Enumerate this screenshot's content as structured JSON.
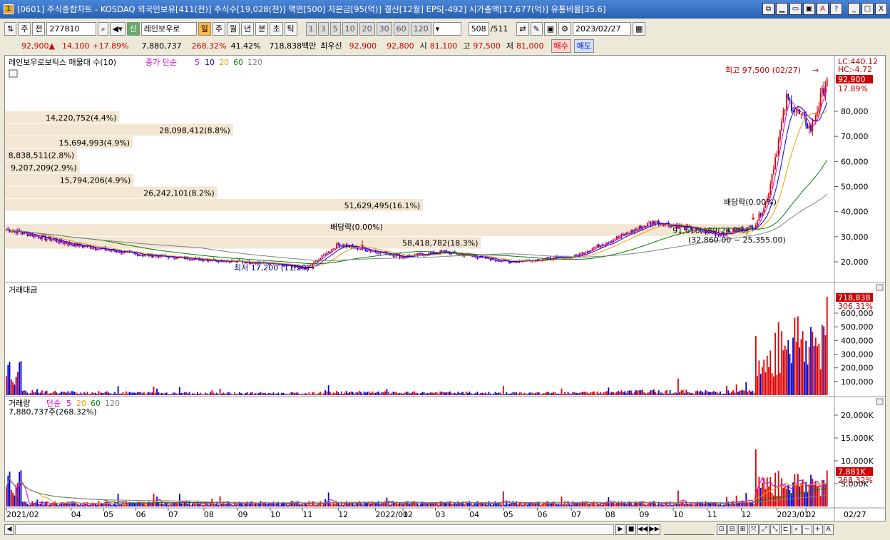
{
  "window": {
    "title": "[0601] 주식종합차트 - KOSDAQ 외국인보유[411(천)] 주식수[19,028(천)] 액면[500] 자본금[95(억)] 결산[12월] EPS[-492] 시가총액[17,677(억)] 유통비율[35.6]",
    "buttons": [
      "⧉",
      "▁",
      "▭",
      "▣",
      "A",
      "?",
      "_",
      "□",
      "X"
    ]
  },
  "toolbar": {
    "market": "주",
    "full_label": "전",
    "code": "277810",
    "sin_label": "신",
    "stock_name": "레인보우로",
    "periods": [
      "일",
      "주",
      "월",
      "년",
      "분",
      "초",
      "틱"
    ],
    "intervals": [
      "1",
      "3",
      "5",
      "10",
      "20",
      "30",
      "60",
      "120"
    ],
    "count": "508",
    "count_total": "/511",
    "date": "2023/02/27"
  },
  "quote": {
    "price": "92,900",
    "arrow": "▲",
    "change": "14,100",
    "change_pct": "+17.89%",
    "volume": "7,880,737",
    "vol_ratio": "268.32%",
    "turnover": "41.42%",
    "amount": "718,838백만",
    "best_label": "최우선",
    "best_ask": "92,900",
    "best_bid": "92,800",
    "open_label": "시",
    "open": "81,100",
    "high_label": "고",
    "high": "97,500",
    "low_label": "저",
    "low": "81,000",
    "buy": "매수",
    "sell": "매도"
  },
  "price_panel": {
    "legend_name": "레인보우로보틱스 매물대 수(10)",
    "ma_label": "종가 단순",
    "ma_periods": [
      {
        "p": "5",
        "color": "#d000d0"
      },
      {
        "p": "10",
        "color": "#0000e0"
      },
      {
        "p": "20",
        "color": "#e8a000"
      },
      {
        "p": "60",
        "color": "#008000"
      },
      {
        "p": "120",
        "color": "#808080"
      }
    ],
    "lc": "LC:440.12",
    "hc": "HC:-4.72",
    "price_tag": "92,900",
    "pct_tag": "17.89%",
    "high_note": "최고 97,500 (02/27)",
    "low_note": "최저 17,200 (11/29)",
    "div_note": "배당락(0.00%)",
    "profile": [
      {
        "label": "14,220,752(4.4%)",
        "price": 77500,
        "share": 0.138
      },
      {
        "label": "28,098,412(8.8%)",
        "price": 72500,
        "share": 0.275
      },
      {
        "label": "15,694,993(4.9%)",
        "price": 67500,
        "share": 0.154
      },
      {
        "label": "8,838,511(2.8%)",
        "price": 62500,
        "share": 0.087
      },
      {
        "label": "9,207,209(2.9%)",
        "price": 57500,
        "share": 0.09
      },
      {
        "label": "15,794,206(4.9%)",
        "price": 52500,
        "share": 0.155
      },
      {
        "label": "26,242,101(8.2%)",
        "price": 47500,
        "share": 0.256
      },
      {
        "label": "51,629,495(16.1%)",
        "price": 42500,
        "share": 0.504
      },
      {
        "label": "91,618,389(28.7%)",
        "price": 32500,
        "share": 0.9
      },
      {
        "label": "58,418,782(18.3%)",
        "price": 27500,
        "share": 0.574
      }
    ],
    "range_note": "(32,860.00 ~ 25,355.00)",
    "y_ticks": [
      "80,000",
      "70,000",
      "60,000",
      "50,000",
      "40,000",
      "30,000",
      "20,000"
    ]
  },
  "amount_panel": {
    "legend": "거래대금",
    "tag": "718,838",
    "tag2": "306.31%",
    "y_ticks": [
      "600,000",
      "500,000",
      "400,000",
      "300,000",
      "200,000",
      "100,000"
    ]
  },
  "volume_panel": {
    "legend": "거래량",
    "ma_label": "단순",
    "ma_periods": [
      {
        "p": "5",
        "color": "#d000d0"
      },
      {
        "p": "20",
        "color": "#e8a000"
      },
      {
        "p": "60",
        "color": "#008000"
      },
      {
        "p": "120",
        "color": "#808080"
      }
    ],
    "value_note": "7,880,737주(268.32%)",
    "tag": "7,881K",
    "tag2": "268.32%",
    "y_ticks": [
      "20,000K",
      "15,000K",
      "10,000K",
      "5,000K"
    ]
  },
  "x_axis": {
    "labels": [
      "2021/02",
      "04",
      "05",
      "06",
      "07",
      "08",
      "09",
      "10",
      "11",
      "12",
      "2022/01",
      "02",
      "03",
      "04",
      "05",
      "06",
      "07",
      "08",
      "09",
      "10",
      "11",
      "12",
      "2023/01",
      "02"
    ],
    "last_date": "02/27"
  },
  "chart_data": {
    "type": "candlestick",
    "price_range": [
      15000,
      97500
    ],
    "price_series_note": "Daily candles, Feb 2021 to Feb 2023",
    "price_key_points": [
      {
        "date": "2021-02",
        "close": 33000
      },
      {
        "date": "2021-04",
        "close": 27000
      },
      {
        "date": "2021-06",
        "close": 23000
      },
      {
        "date": "2021-08",
        "close": 21000
      },
      {
        "date": "2021-10",
        "close": 19500
      },
      {
        "date": "2021-11-29",
        "close": 17200
      },
      {
        "date": "2021-12",
        "close": 27000
      },
      {
        "date": "2022-02",
        "close": 22000
      },
      {
        "date": "2022-03",
        "close": 24000
      },
      {
        "date": "2022-05",
        "close": 20000
      },
      {
        "date": "2022-07",
        "close": 22000
      },
      {
        "date": "2022-09",
        "close": 36000
      },
      {
        "date": "2022-11",
        "close": 31000
      },
      {
        "date": "2022-12",
        "close": 34000
      },
      {
        "date": "2023-01-10",
        "close": 45000
      },
      {
        "date": "2023-01-25",
        "close": 85000
      },
      {
        "date": "2023-02-15",
        "close": 73000
      },
      {
        "date": "2023-02-27",
        "close": 92900
      }
    ]
  }
}
